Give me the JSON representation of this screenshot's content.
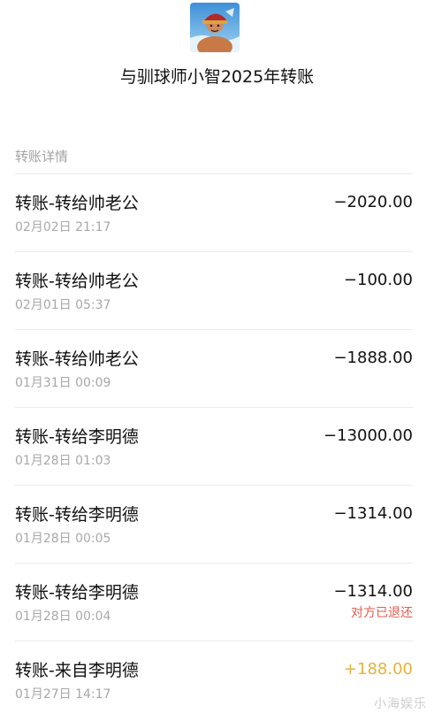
{
  "header": {
    "avatar_icon": "profile-avatar",
    "title": "与驯球师小智2025年转账"
  },
  "section_label": "转账详情",
  "transactions": [
    {
      "title": "转账-转给帅老公",
      "time": "02月02日 21:17",
      "amount": "−2020.00",
      "status": ""
    },
    {
      "title": "转账-转给帅老公",
      "time": "02月01日 05:37",
      "amount": "−100.00",
      "status": ""
    },
    {
      "title": "转账-转给帅老公",
      "time": "01月31日 00:09",
      "amount": "−1888.00",
      "status": ""
    },
    {
      "title": "转账-转给李明德",
      "time": "01月28日 01:03",
      "amount": "−13000.00",
      "status": ""
    },
    {
      "title": "转账-转给李明德",
      "time": "01月28日 00:05",
      "amount": "−1314.00",
      "status": ""
    },
    {
      "title": "转账-转给李明德",
      "time": "01月28日 00:04",
      "amount": "−1314.00",
      "status": "对方已退还"
    },
    {
      "title": "转账-来自李明德",
      "time": "01月27日 14:17",
      "amount": "+188.00",
      "status": ""
    }
  ],
  "colors": {
    "income": "#e8b23a",
    "refund_status": "#e55b4d",
    "secondary_text": "#a8a8a8"
  },
  "watermark": "小海娱乐"
}
